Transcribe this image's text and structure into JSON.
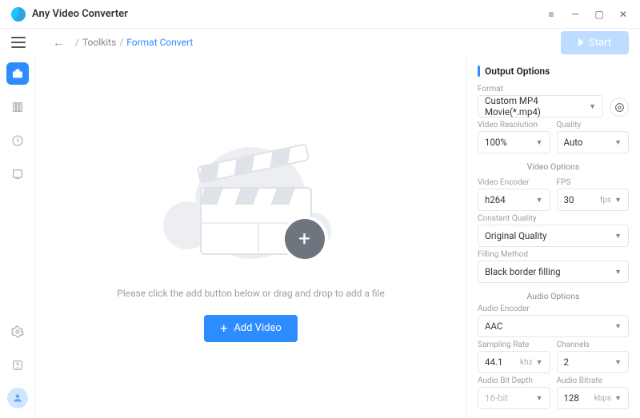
{
  "app": {
    "title": "Any Video Converter"
  },
  "nav": {
    "toolkits": "Toolkits",
    "format_convert": "Format Convert",
    "start": "Start"
  },
  "main": {
    "hint": "Please click the add button below or drag and drop to add a file",
    "add_video": "Add Video"
  },
  "panel": {
    "title": "Output Options",
    "format_label": "Format",
    "format_value": "Custom MP4 Movie(*.mp4)",
    "video_res_label": "Video Resolution",
    "video_res_value": "100%",
    "quality_label": "Quality",
    "quality_value": "Auto",
    "video_options": "Video Options",
    "video_enc_label": "Video Encoder",
    "video_enc_value": "h264",
    "fps_label": "FPS",
    "fps_value": "30",
    "fps_unit": "fps",
    "cq_label": "Constant Quality",
    "cq_value": "Original Quality",
    "fill_label": "Filling Method",
    "fill_value": "Black border filling",
    "audio_options": "Audio Options",
    "audio_enc_label": "Audio Encoder",
    "audio_enc_value": "AAC",
    "srate_label": "Sampling Rate",
    "srate_value": "44.1",
    "srate_unit": "khz",
    "channels_label": "Channels",
    "channels_value": "2",
    "bitdepth_label": "Audio Bit Depth",
    "bitdepth_value": "16-bit",
    "abitrate_label": "Audio Bitrate",
    "abitrate_value": "128",
    "abitrate_unit": "kbps"
  }
}
